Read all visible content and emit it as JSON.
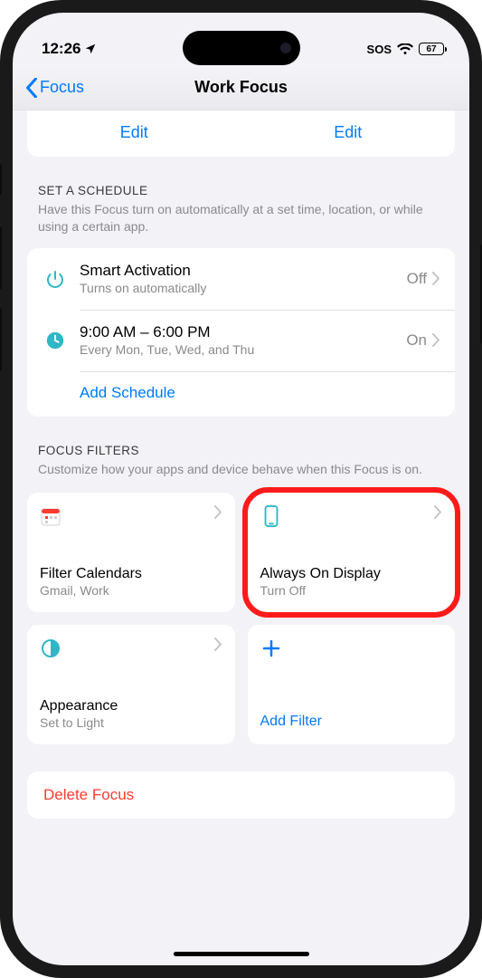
{
  "statusbar": {
    "time": "12:26",
    "sos": "SOS",
    "battery_pct": "67"
  },
  "nav": {
    "back_label": "Focus",
    "title": "Work Focus"
  },
  "edit_row": {
    "left": "Edit",
    "right": "Edit"
  },
  "schedule": {
    "header": "SET A SCHEDULE",
    "sub": "Have this Focus turn on automatically at a set time, location, or while using a certain app.",
    "rows": [
      {
        "title": "Smart Activation",
        "sub": "Turns on automatically",
        "value": "Off"
      },
      {
        "title": "9:00 AM – 6:00 PM",
        "sub": "Every Mon, Tue, Wed, and Thu",
        "value": "On"
      }
    ],
    "add_label": "Add Schedule"
  },
  "filters": {
    "header": "FOCUS FILTERS",
    "sub": "Customize how your apps and device behave when this Focus is on.",
    "cards": [
      {
        "title": "Filter Calendars",
        "sub": "Gmail, Work"
      },
      {
        "title": "Always On Display",
        "sub": "Turn Off"
      },
      {
        "title": "Appearance",
        "sub": "Set to Light"
      }
    ],
    "add_label": "Add Filter"
  },
  "delete_label": "Delete Focus"
}
